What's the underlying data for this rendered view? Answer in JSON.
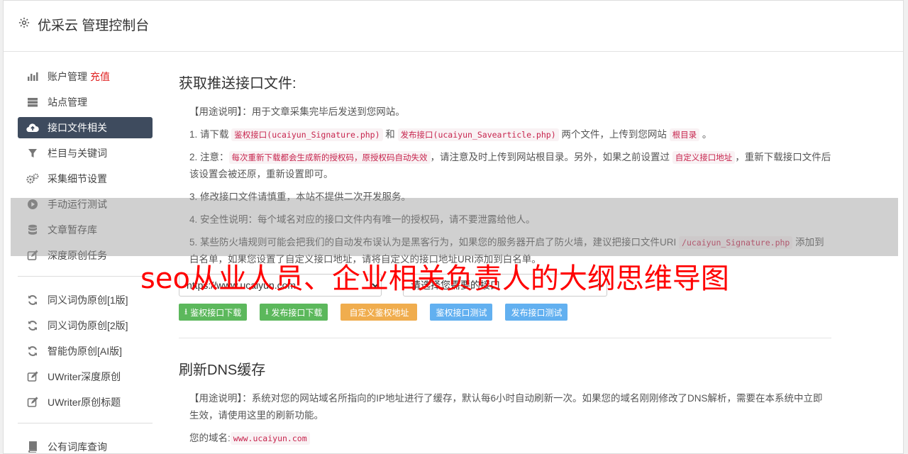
{
  "app": {
    "title": "优采云 管理控制台"
  },
  "sidebar": {
    "groups": [
      [
        {
          "label": "账户管理",
          "badge": "充值",
          "icon": "bar-chart-icon"
        },
        {
          "label": "站点管理",
          "icon": "server-icon"
        },
        {
          "label": "接口文件相关",
          "icon": "cloud-upload-icon",
          "active": true
        },
        {
          "label": "栏目与关键词",
          "icon": "filter-icon"
        },
        {
          "label": "采集细节设置",
          "icon": "gears-icon"
        },
        {
          "label": "手动运行测试",
          "icon": "play-circle-icon"
        },
        {
          "label": "文章暂存库",
          "icon": "database-icon"
        },
        {
          "label": "深度原创任务",
          "icon": "edit-icon"
        }
      ],
      [
        {
          "label": "同义词伪原创[1版]",
          "icon": "refresh-icon"
        },
        {
          "label": "同义词伪原创[2版]",
          "icon": "refresh-icon"
        },
        {
          "label": "智能伪原创[AI版]",
          "icon": "refresh-icon"
        },
        {
          "label": "UWriter深度原创",
          "icon": "edit-icon"
        },
        {
          "label": "UWriter原创标题",
          "icon": "edit-icon"
        }
      ],
      [
        {
          "label": "公有词库查询",
          "icon": "book-icon"
        }
      ]
    ]
  },
  "section1": {
    "title": "获取推送接口文件:",
    "usage_label": "【用途说明】",
    "usage_text": "：用于文章采集完毕后发送到您网站。",
    "step1": {
      "pre": "1. 请下载 ",
      "code1": "鉴权接口(ucaiyun_Signature.php)",
      "mid": " 和 ",
      "code2": "发布接口(ucaiyun_Savearticle.php)",
      "post": " 两个文件，上传到您网站 ",
      "code3": "根目录",
      "end": " 。"
    },
    "step2": {
      "pre": "2. 注意：",
      "code1": "每次重新下载都会生成新的授权码，原授权码自动失效",
      "mid": "，请注意及时上传到网站根目录。另外，如果之前设置过 ",
      "code2": "自定义接口地址",
      "post": "，重新下载接口文件后该设置会被还原，重新设置即可。"
    },
    "step3": "3. 修改接口文件请慎重，本站不提供二次开发服务。",
    "step4": "4. 安全性说明：每个域名对应的接口文件内有唯一的授权码，请不要泄露给他人。",
    "step5": {
      "pre": "5. 某些防火墙规则可能会把我们的自动发布误认为是黑客行为，如果您的服务器开启了防火墙，建议把接口文件URI ",
      "code1": "/ucaiyun_Signature.php",
      "post": " 添加到白名单，如果您设置了自定义接口地址，请将自定义的接口地址URI添加到白名单。"
    },
    "site_select": {
      "value": "https://www.ucaiyun.com"
    },
    "api_select": {
      "value": "请选择您需要的接口"
    },
    "buttons": {
      "auth_download": "鉴权接口下载",
      "publish_download": "发布接口下载",
      "custom_auth": "自定义鉴权地址",
      "auth_test": "鉴权接口测试",
      "publish_test": "发布接口测试"
    }
  },
  "section2": {
    "title": "刷新DNS缓存",
    "usage_label": "【用途说明】",
    "usage_text": "：系统对您的网站域名所指向的IP地址进行了缓存，默认每6小时自动刷新一次。如果您的域名刚刚修改了DNS解析，需要在本系统中立即生效，请使用这里的刷新功能。",
    "domain_label": "您的域名:",
    "domain_value": "www.ucaiyun.com"
  },
  "watermark": {
    "text": "seo从业人员、企业相关负责人的大纲思维导图"
  },
  "colors": {
    "active_bg": "#3e4b5e",
    "code_red": "#c7254e",
    "green": "#5cb85c",
    "orange": "#f0ad4e",
    "blue": "#62b0f0",
    "watermark": "#ff0000"
  }
}
